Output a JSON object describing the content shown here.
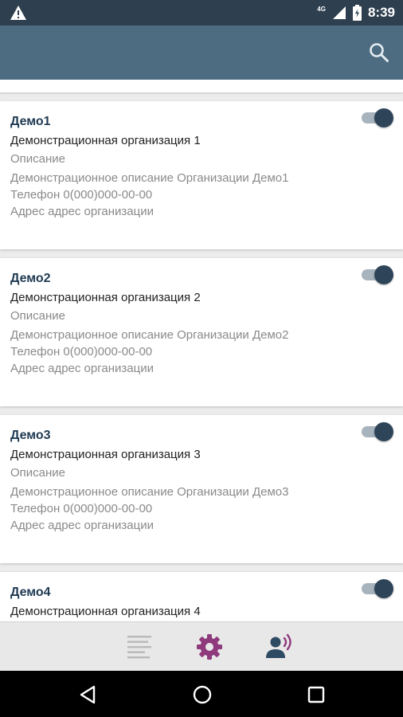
{
  "status_bar": {
    "time": "8:39",
    "network": "4G",
    "icons": [
      "warning-icon",
      "signal-icon",
      "battery-charging-icon"
    ]
  },
  "app_bar": {
    "icons": [
      "search-icon"
    ]
  },
  "cards": [
    {
      "name": "Демо1",
      "org": "Демонстрационная организация 1",
      "label": "Описание",
      "description": "Демонстрационное описание Организации Демо1",
      "phone": "Телефон 0(000)000-00-00",
      "address": "Адрес адрес организации",
      "enabled": true
    },
    {
      "name": "Демо2",
      "org": "Демонстрационная организация 2",
      "label": "Описание",
      "description": "Демонстрационное описание Организации Демо2",
      "phone": "Телефон 0(000)000-00-00",
      "address": "Адрес адрес организации",
      "enabled": true
    },
    {
      "name": "Демо3",
      "org": "Демонстрационная организация 3",
      "label": "Описание",
      "description": "Демонстрационное описание Организации Демо3",
      "phone": "Телефон 0(000)000-00-00",
      "address": "Адрес адрес организации",
      "enabled": true
    },
    {
      "name": "Демо4",
      "org": "Демонстрационная организация 4",
      "enabled": true
    }
  ],
  "bottom_nav": {
    "icons": [
      "list-icon",
      "settings-gear-icon",
      "contact-broadcast-icon"
    ]
  },
  "system_nav": {
    "icons": [
      "back-icon",
      "home-icon",
      "recents-icon"
    ]
  },
  "colors": {
    "status_bar": "#2e3f4f",
    "app_bar": "#4d6b81",
    "toggle_thumb": "#2d4459",
    "toggle_track": "#a7b3bd",
    "settings_accent": "#8e3a7c",
    "contact_accent": "#2f4a63",
    "list_background": "#ececec"
  }
}
